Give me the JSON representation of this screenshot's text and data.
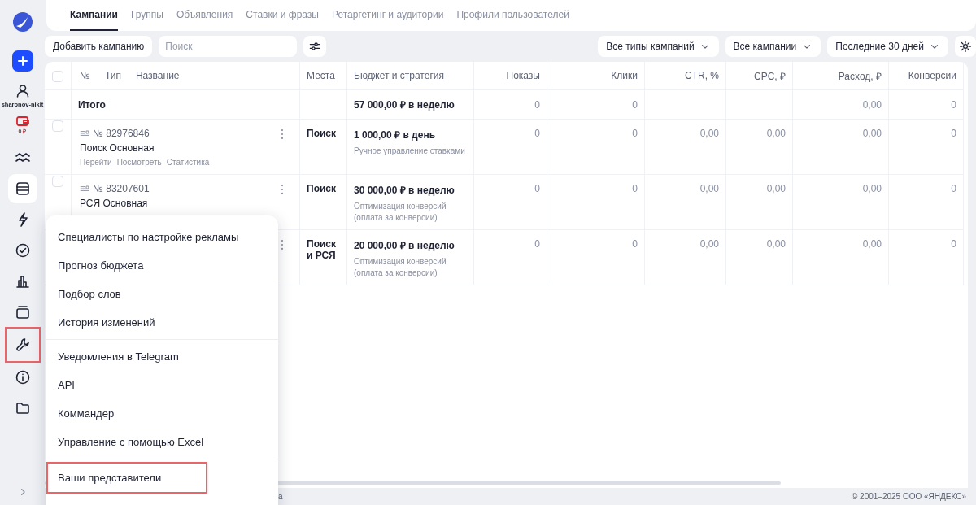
{
  "sidebar": {
    "user": "sharonov-nikit",
    "balance": "0 ₽",
    "items": [
      {
        "selected": false,
        "highlighted": false
      },
      {
        "selected": true,
        "highlighted": false
      },
      {
        "selected": false,
        "highlighted": false
      },
      {
        "selected": false,
        "highlighted": false
      },
      {
        "selected": false,
        "highlighted": false
      },
      {
        "selected": false,
        "highlighted": false
      },
      {
        "selected": false,
        "highlighted": true
      },
      {
        "selected": false,
        "highlighted": false
      },
      {
        "selected": false,
        "highlighted": false
      }
    ]
  },
  "tabs": [
    {
      "label": "Кампании",
      "selected": true
    },
    {
      "label": "Группы",
      "selected": false
    },
    {
      "label": "Объявления",
      "selected": false
    },
    {
      "label": "Ставки и фразы",
      "selected": false
    },
    {
      "label": "Ретаргетинг и аудитории",
      "selected": false
    },
    {
      "label": "Профили пользователей",
      "selected": false
    }
  ],
  "toolbar": {
    "add_button": "Добавить кампанию",
    "search": {
      "placeholder": "Поиск"
    },
    "filters": [
      "Все типы кампаний",
      "Все кампании",
      "Последние 30 дней"
    ]
  },
  "table": {
    "columns": [
      "№",
      "Тип",
      "Название",
      "Места",
      "Бюджет и стратегия",
      "Показы",
      "Клики",
      "CTR, %",
      "CPC, ₽",
      "Расход, ₽",
      "Конверсии"
    ],
    "select_all": {
      "checked": false
    },
    "total": {
      "label": "Итого",
      "budget": "57 000,00 ₽ в неделю",
      "impressions": "0",
      "clicks": "0",
      "spend": "0,00",
      "conversions": "0"
    },
    "rows": [
      {
        "checked": false,
        "number": "№ 82976846",
        "name": "Поиск Основная",
        "links": [
          "Перейти",
          "Посмотреть",
          "Статистика"
        ],
        "places": "Поиск",
        "budget": "1 000,00 ₽ в день",
        "strategy": "Ручное управление ставками",
        "values": [
          "0",
          "0",
          "0,00",
          "0,00",
          "0,00",
          "0"
        ]
      },
      {
        "checked": false,
        "number": "№ 83207601",
        "name": "РСЯ Основная",
        "places": "Поиск",
        "budget": "30 000,00 ₽ в неделю",
        "strategy": "Оптимизация конверсий (оплата за конверсии)",
        "values": [
          "0",
          "0",
          "0,00",
          "0,00",
          "0,00",
          "0"
        ]
      },
      {
        "places": "Поиск и РСЯ",
        "budget": "20 000,00 ₽ в неделю",
        "strategy": "Оптимизация конверсий (оплата за конверсии)",
        "values": [
          "0",
          "0",
          "0,00",
          "0,00",
          "0,00",
          "0"
        ]
      }
    ]
  },
  "menu": {
    "groups": [
      [
        {
          "label": "Специалисты по настройке рекламы",
          "highlighted": false
        },
        {
          "label": "Прогноз бюджета",
          "highlighted": false
        },
        {
          "label": "Подбор слов",
          "highlighted": false
        },
        {
          "label": "История изменений",
          "highlighted": false
        }
      ],
      [
        {
          "label": "Уведомления в Telegram",
          "highlighted": false
        },
        {
          "label": "API",
          "highlighted": false
        },
        {
          "label": "Коммандер",
          "highlighted": false
        },
        {
          "label": "Управление с помощью Excel",
          "highlighted": false
        }
      ],
      [
        {
          "label": "Ваши представители",
          "highlighted": true
        }
      ]
    ]
  },
  "footer": {
    "fragment": "a",
    "copyright": "© 2001–2025 ООО «ЯНДЕКС»"
  }
}
